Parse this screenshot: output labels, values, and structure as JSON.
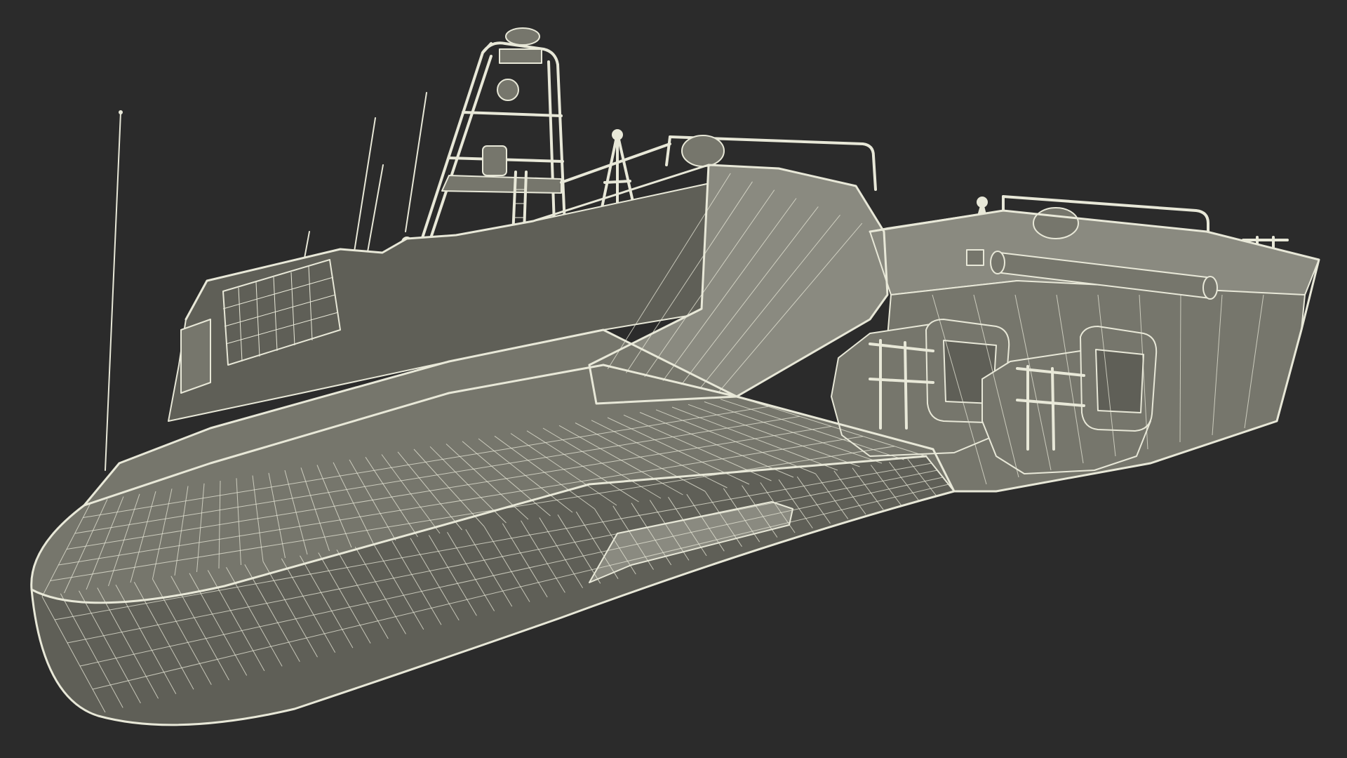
{
  "render": {
    "icon": "boat-wireframe-icon",
    "colors": {
      "background": "#2b2b2b",
      "hull": "#76766c",
      "hull_shadow": "#5f5f57",
      "hull_light": "#8a8a80",
      "wire": "#e8e8d8"
    }
  }
}
